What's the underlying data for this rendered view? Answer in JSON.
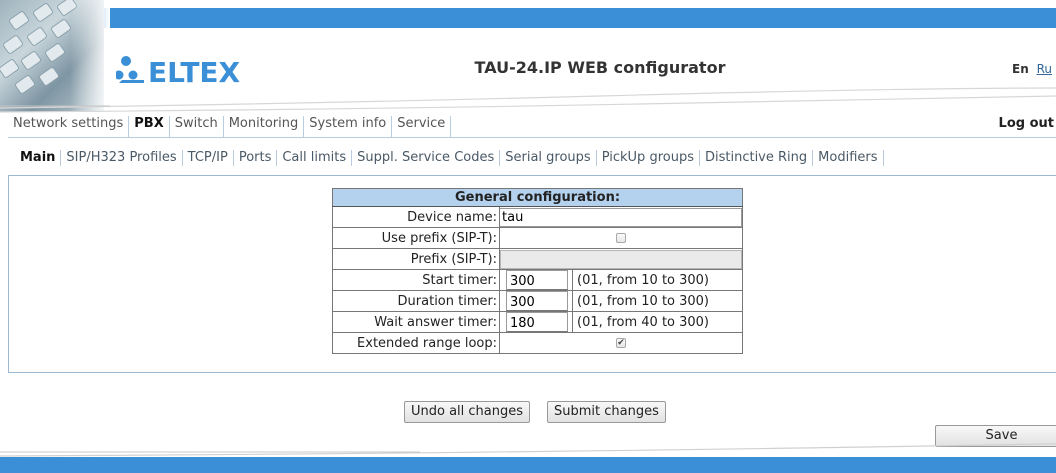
{
  "header": {
    "brand": "ELTEX",
    "title": "TAU-24.IP WEB configurator",
    "lang_en": "En",
    "lang_ru": "Ru",
    "accent": "#3a8fd6"
  },
  "main_menu": {
    "items": [
      {
        "label": "Network settings",
        "active": false
      },
      {
        "label": "PBX",
        "active": true
      },
      {
        "label": "Switch",
        "active": false
      },
      {
        "label": "Monitoring",
        "active": false
      },
      {
        "label": "System info",
        "active": false
      },
      {
        "label": "Service",
        "active": false
      }
    ],
    "logout": "Log out"
  },
  "sub_menu": {
    "items": [
      {
        "label": "Main",
        "active": true
      },
      {
        "label": "SIP/H323 Profiles",
        "active": false
      },
      {
        "label": "TCP/IP",
        "active": false
      },
      {
        "label": "Ports",
        "active": false
      },
      {
        "label": "Call limits",
        "active": false
      },
      {
        "label": "Suppl. Service Codes",
        "active": false
      },
      {
        "label": "Serial groups",
        "active": false
      },
      {
        "label": "PickUp groups",
        "active": false
      },
      {
        "label": "Distinctive Ring",
        "active": false
      },
      {
        "label": "Modifiers",
        "active": false
      }
    ]
  },
  "general": {
    "heading": "General configuration:",
    "device_name": {
      "label": "Device name:",
      "value": "tau"
    },
    "use_prefix": {
      "label": "Use prefix (SIP-T):",
      "checked": false
    },
    "prefix": {
      "label": "Prefix (SIP-T):",
      "value": ""
    },
    "start_timer": {
      "label": "Start timer:",
      "value": "300",
      "hint": "(01, from 10 to 300)"
    },
    "duration_timer": {
      "label": "Duration timer:",
      "value": "300",
      "hint": "(01, from 10 to 300)"
    },
    "wait_answer_timer": {
      "label": "Wait answer timer:",
      "value": "180",
      "hint": "(01, from 40 to 300)"
    },
    "extended_range_loop": {
      "label": "Extended range loop:",
      "checked": true
    }
  },
  "buttons": {
    "undo": "Undo all changes",
    "submit": "Submit changes",
    "save": "Save"
  }
}
